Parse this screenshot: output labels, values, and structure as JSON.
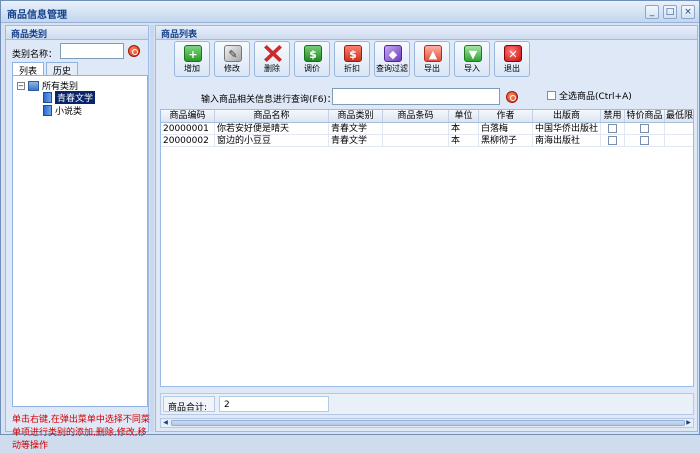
{
  "window": {
    "title": "商品信息管理",
    "buttons": [
      "_",
      "□",
      "×"
    ]
  },
  "left_panel": {
    "header": "商品类别",
    "category_label": "类别名称：",
    "category_value": "",
    "tabs": [
      "列表",
      "历史"
    ],
    "tree": {
      "root": "所有类别",
      "expander": "−",
      "children": [
        "青春文学",
        "小说类"
      ],
      "selected": "青春文学"
    },
    "hint": "单击右键,在弹出菜单中选择不同菜单项进行类别的添加,删除,修改,移动等操作"
  },
  "right_panel": {
    "header": "商品列表",
    "toolbar": [
      {
        "label": "增加",
        "icon": "add-icon",
        "glyph": "+"
      },
      {
        "label": "修改",
        "icon": "edit-icon",
        "glyph": "✎"
      },
      {
        "label": "删除",
        "icon": "delete-icon",
        "glyph": ""
      },
      {
        "label": "调价",
        "icon": "price-adjust-icon",
        "glyph": "$"
      },
      {
        "label": "折扣",
        "icon": "discount-icon",
        "glyph": "$"
      },
      {
        "label": "查询过滤",
        "icon": "filter-icon",
        "glyph": "◆"
      },
      {
        "label": "导出",
        "icon": "export-icon",
        "glyph": "▲"
      },
      {
        "label": "导入",
        "icon": "import-icon",
        "glyph": "▼"
      },
      {
        "label": "退出",
        "icon": "exit-icon",
        "glyph": "✕"
      }
    ],
    "query_label": "输入商品相关信息进行查询(F6)：",
    "query_value": "",
    "select_all_label": "全选商品(Ctrl+A)",
    "columns": [
      "商品编码",
      "商品名称",
      "商品类别",
      "商品条码",
      "单位",
      "作者",
      "出版商",
      "禁用",
      "特价商品",
      "最低限"
    ],
    "rows": [
      {
        "code": "20000001",
        "name": "你若安好便是晴天",
        "category": "青春文学",
        "barcode": "",
        "unit": "本",
        "author": "白落梅",
        "publisher": "中国华侨出版社"
      },
      {
        "code": "20000002",
        "name": "窗边的小豆豆",
        "category": "青春文学",
        "barcode": "",
        "unit": "本",
        "author": "黑柳彻子",
        "publisher": "南海出版社"
      }
    ],
    "footer": {
      "label": "商品合计:",
      "value": "2"
    }
  }
}
